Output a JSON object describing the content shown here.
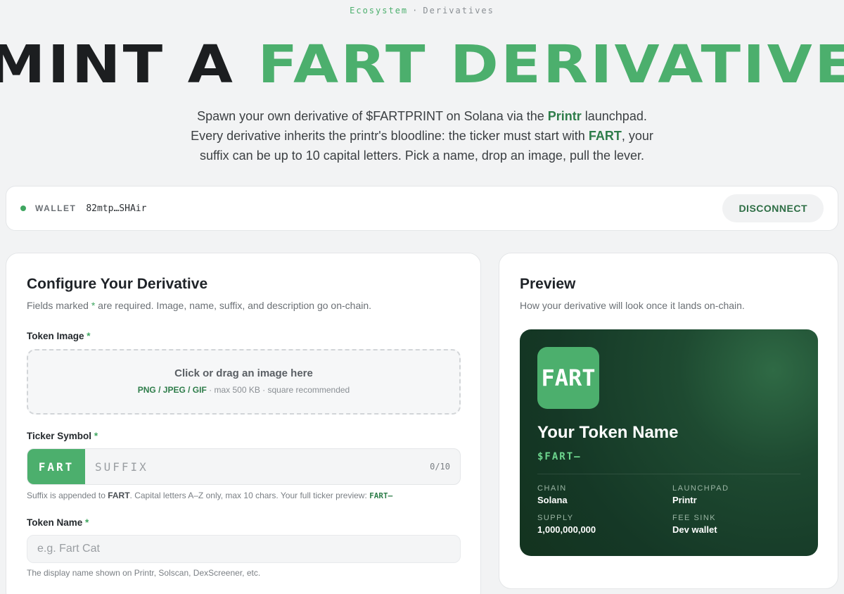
{
  "breadcrumb": {
    "parent": "Ecosystem",
    "separator": "·",
    "current": "Derivatives"
  },
  "hero": {
    "title_plain": "MINT A",
    "title_accent": "FART DERIVATIVE",
    "sub_line1_a": "Spawn your own derivative of $FARTPRINT on Solana via the ",
    "sub_line1_b": "Printr",
    "sub_line1_c": " launchpad.",
    "sub_line2_a": "Every derivative inherits the printr's bloodline: the ticker must start with ",
    "sub_line2_b": "FART",
    "sub_line2_c": ", your",
    "sub_line3": "suffix can be up to 10 capital letters. Pick a name, drop an image, pull the lever."
  },
  "wallet": {
    "label": "WALLET",
    "address": "82mtp…SHAir",
    "disconnect_label": "DISCONNECT"
  },
  "config": {
    "title": "Configure Your Derivative",
    "sub_a": "Fields marked ",
    "sub_star": "*",
    "sub_b": " are required. Image, name, suffix, and description go on-chain.",
    "image": {
      "label": "Token Image",
      "required": "*",
      "dropzone_main": "Click or drag an image here",
      "dropzone_formats": "PNG / JPEG / GIF",
      "dropzone_rest": " · max 500 KB · square recommended"
    },
    "ticker": {
      "label": "Ticker Symbol",
      "required": "*",
      "prefix": "FART",
      "placeholder": "SUFFIX",
      "count": "0/10",
      "hint_a": "Suffix is appended to ",
      "hint_b": "FART",
      "hint_c": ". Capital letters A–Z only, max 10 chars. Your full ticker preview: ",
      "hint_preview": "FART—"
    },
    "name": {
      "label": "Token Name",
      "required": "*",
      "placeholder": "e.g. Fart Cat",
      "hint": "The display name shown on Printr, Solscan, DexScreener, etc."
    }
  },
  "preview": {
    "title": "Preview",
    "sub": "How your derivative will look once it lands on-chain.",
    "logo_text": "FART",
    "token_name": "Your Token Name",
    "token_ticker": "$FART—",
    "meta": [
      {
        "label": "CHAIN",
        "value": "Solana"
      },
      {
        "label": "LAUNCHPAD",
        "value": "Printr"
      },
      {
        "label": "SUPPLY",
        "value": "1,000,000,000"
      },
      {
        "label": "FEE SINK",
        "value": "Dev wallet"
      }
    ]
  },
  "colors": {
    "accent": "#4caf6d",
    "accent_dark": "#2e7d4a",
    "card_bg": "#153826"
  }
}
